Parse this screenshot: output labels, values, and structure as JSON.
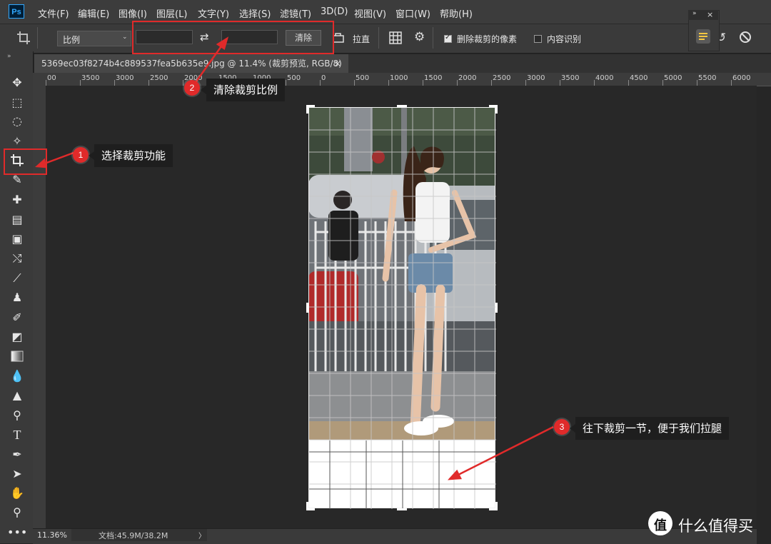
{
  "menu": {
    "logo": "Ps",
    "items": [
      "文件(F)",
      "编辑(E)",
      "图像(I)",
      "图层(L)",
      "文字(Y)",
      "选择(S)",
      "滤镜(T)",
      "3D(D)",
      "视图(V)",
      "窗口(W)",
      "帮助(H)"
    ]
  },
  "options": {
    "ratio_select": "比例",
    "width_value": "",
    "height_value": "",
    "clear_button": "清除",
    "straighten_label": "拉直",
    "delete_cropped_label": "删除裁剪的像素",
    "delete_cropped_checked": true,
    "content_aware_label": "内容识别",
    "content_aware_checked": false
  },
  "document": {
    "tab_title": "5369ec03f8274b4c889537fea5b635e9.jpg @ 11.4% (裁剪预览, RGB/8)",
    "tab_close": "×"
  },
  "ruler": {
    "top_labels": [
      "00",
      "3500",
      "3000",
      "2500",
      "2000",
      "1500",
      "1000",
      "500",
      "0",
      "500",
      "1000",
      "1500",
      "2000",
      "2500",
      "3000",
      "3500",
      "4000",
      "4500",
      "5000",
      "5500",
      "6000",
      "6"
    ]
  },
  "status": {
    "zoom": "11.36%",
    "doc_info": "文档:45.9M/38.2M",
    "arrow": "〉"
  },
  "annotations": {
    "step1": {
      "number": "1",
      "text": "选择裁剪功能"
    },
    "step2": {
      "number": "2",
      "text": "清除裁剪比例"
    },
    "step3": {
      "number": "3",
      "text": "往下裁剪一节，便于我们拉腿"
    }
  },
  "watermark": {
    "text": "什么值得买",
    "logo_char": "值"
  },
  "colors": {
    "annotation_red": "#e02a2a",
    "ps_blue": "#31a8ff"
  }
}
